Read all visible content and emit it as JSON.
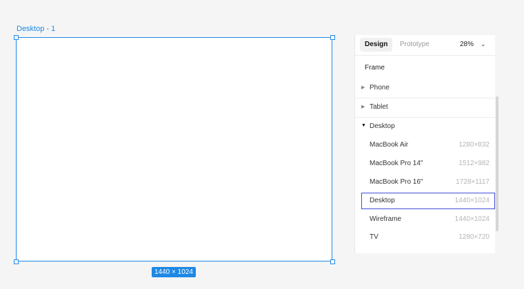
{
  "canvas": {
    "frame_label": "Desktop - 1",
    "dimension_badge": "1440 × 1024"
  },
  "panel": {
    "tabs": [
      {
        "label": "Design",
        "active": true
      },
      {
        "label": "Prototype",
        "active": false
      }
    ],
    "zoom": "28%",
    "section_title": "Frame",
    "categories": {
      "phone": "Phone",
      "tablet": "Tablet",
      "desktop": "Desktop"
    },
    "desktop_items": [
      {
        "name": "MacBook Air",
        "size": "1280×832",
        "selected": false
      },
      {
        "name": "MacBook Pro 14\"",
        "size": "1512×982",
        "selected": false
      },
      {
        "name": "MacBook Pro 16\"",
        "size": "1728×1117",
        "selected": false
      },
      {
        "name": "Desktop",
        "size": "1440×1024",
        "selected": true
      },
      {
        "name": "Wireframe",
        "size": "1440×1024",
        "selected": false
      },
      {
        "name": "TV",
        "size": "1280×720",
        "selected": false
      }
    ]
  },
  "colors": {
    "selection": "#1e88e5",
    "highlight": "#3f4bd6"
  },
  "icons": {
    "collapsed": "triangle-right",
    "expanded": "triangle-down",
    "zoom_menu": "chevron-down"
  }
}
